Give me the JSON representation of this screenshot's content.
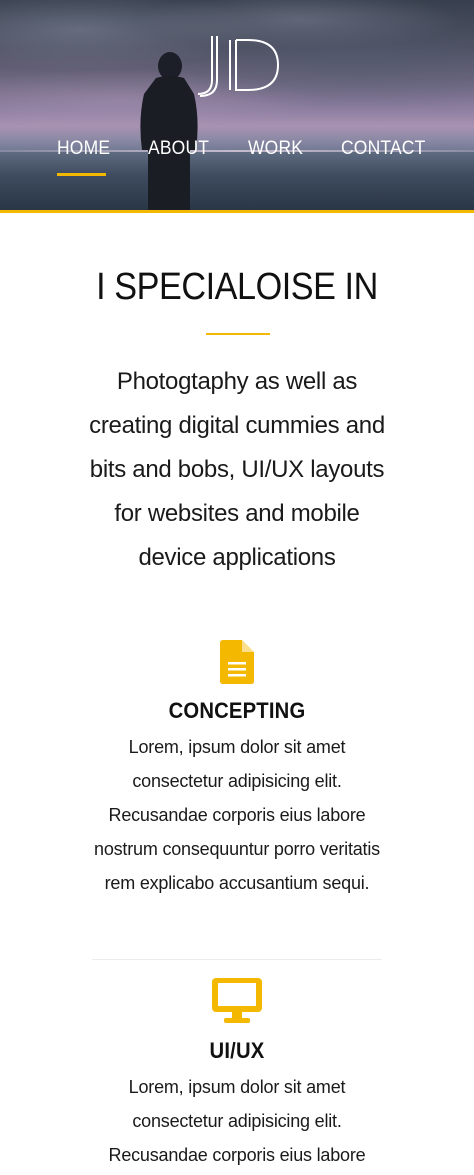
{
  "brand": {
    "logo_text": "JD",
    "accent_color": "#f5b800"
  },
  "nav": {
    "items": [
      {
        "label": "HOME",
        "active": true
      },
      {
        "label": "ABOUT",
        "active": false
      },
      {
        "label": "WORK",
        "active": false
      },
      {
        "label": "CONTACT",
        "active": false
      }
    ]
  },
  "specialise": {
    "title": "I SPECIALOISE IN",
    "text": "Photogtaphy as well as creating digital cummies and bits and bobs, UI/UX layouts for websites and mobile device applications"
  },
  "services": [
    {
      "icon": "document-icon",
      "title": "CONCEPTING",
      "text": "Lorem, ipsum dolor sit amet consectetur adipisicing elit. Recusandae corporis eius labore nostrum consequuntur porro veritatis rem explicabo accusantium sequi."
    },
    {
      "icon": "desktop-icon",
      "title": "UI/UX",
      "text": "Lorem, ipsum dolor sit amet consectetur adipisicing elit. Recusandae corporis eius labore"
    }
  ]
}
